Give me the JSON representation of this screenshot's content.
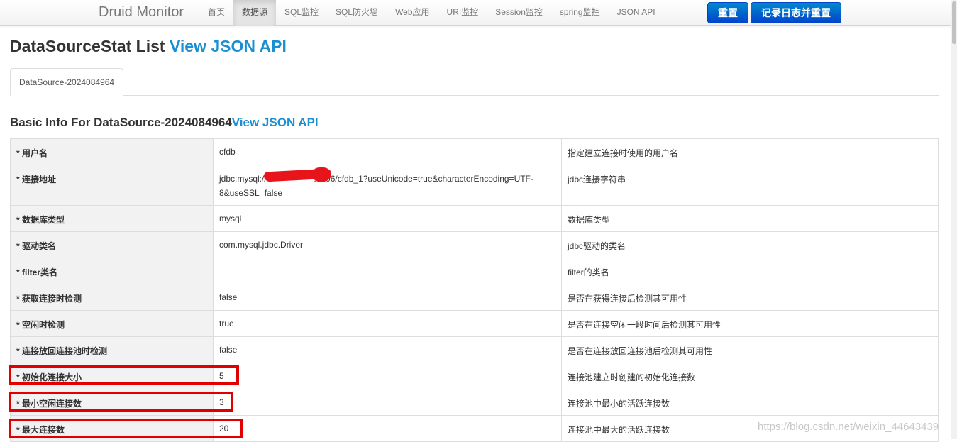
{
  "navbar": {
    "brand": "Druid Monitor",
    "links": [
      {
        "label": "首页",
        "active": false
      },
      {
        "label": "数据源",
        "active": true
      },
      {
        "label": "SQL监控",
        "active": false
      },
      {
        "label": "SQL防火墙",
        "active": false
      },
      {
        "label": "Web应用",
        "active": false
      },
      {
        "label": "URI监控",
        "active": false
      },
      {
        "label": "Session监控",
        "active": false
      },
      {
        "label": "spring监控",
        "active": false
      },
      {
        "label": "JSON API",
        "active": false
      }
    ],
    "reset_button": "重置",
    "log_reset_button": "记录日志并重置"
  },
  "page": {
    "title": "DataSourceStat List",
    "title_link": "View JSON API"
  },
  "tabs": [
    {
      "label": "DataSource-2024084964"
    }
  ],
  "section": {
    "title": "Basic Info For DataSource-2024084964",
    "title_link": "View JSON API"
  },
  "table": {
    "rows": [
      {
        "key": "* 用户名",
        "value": "cfdb",
        "desc": "指定建立连接时使用的用户名"
      },
      {
        "key": "* 连接地址",
        "value_line1": "jdbc:mysql://                    :3306/cfdb_1?useUnicode=true&characterEncoding=UTF-",
        "value_line2": "8&useSSL=false",
        "desc": "jdbc连接字符串"
      },
      {
        "key": "* 数据库类型",
        "value": "mysql",
        "desc": "数据库类型"
      },
      {
        "key": "* 驱动类名",
        "value": "com.mysql.jdbc.Driver",
        "desc": "jdbc驱动的类名"
      },
      {
        "key": "* filter类名",
        "value": "",
        "desc": "filter的类名"
      },
      {
        "key": "* 获取连接时检测",
        "value": "false",
        "desc": "是否在获得连接后检测其可用性"
      },
      {
        "key": "* 空闲时检测",
        "value": "true",
        "desc": "是否在连接空闲一段时间后检测其可用性"
      },
      {
        "key": "* 连接放回连接池时检测",
        "value": "false",
        "desc": "是否在连接放回连接池后检测其可用性"
      },
      {
        "key": "* 初始化连接大小",
        "value": "5",
        "desc": "连接池建立时创建的初始化连接数"
      },
      {
        "key": "* 最小空闲连接数",
        "value": "3",
        "desc": "连接池中最小的活跃连接数"
      },
      {
        "key": "* 最大连接数",
        "value": "20",
        "desc": "连接池中最大的活跃连接数"
      }
    ]
  },
  "watermark": "https://blog.csdn.net/weixin_44643439",
  "colors": {
    "link": "#1a8fd1",
    "primary_button": "#0066cc",
    "highlight": "#e00000"
  }
}
